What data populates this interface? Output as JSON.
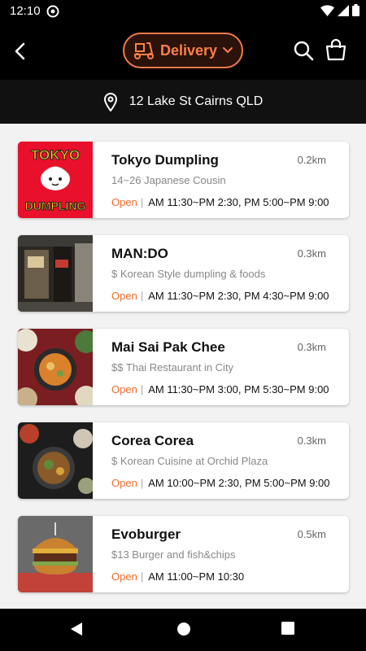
{
  "status_bar": {
    "time": "12:10"
  },
  "header": {
    "delivery_label": "Delivery"
  },
  "address": {
    "text": "12 Lake St Cairns QLD"
  },
  "restaurants": [
    {
      "name": "Tokyo Dumpling",
      "distance": "0.2km",
      "description": "14~26 Japanese Cousin",
      "status": "Open",
      "hours": "AM 11:30~PM 2:30, PM 5:00~PM 9:00",
      "thumb_text_top": "TOKYO",
      "thumb_text_bottom": "DUMPLING"
    },
    {
      "name": "MAN:DO",
      "distance": "0.3km",
      "description": "$ Korean Style dumpling & foods",
      "status": "Open",
      "hours": "AM 11:30~PM 2:30, PM 4:30~PM 9:00"
    },
    {
      "name": "Mai Sai Pak Chee",
      "distance": "0.3km",
      "description": "$$ Thai Restaurant in City",
      "status": "Open",
      "hours": "AM 11:30~PM 3:00, PM 5:30~PM 9:00"
    },
    {
      "name": "Corea Corea",
      "distance": "0.3km",
      "description": "$ Korean Cuisine at Orchid Plaza",
      "status": "Open",
      "hours": "AM 10:00~PM 2:30, PM 5:00~PM 9:00"
    },
    {
      "name": "Evoburger",
      "distance": "0.5km",
      "description": "$13 Burger and fish&chips",
      "status": "Open",
      "hours": "AM 11:00~PM 10:30"
    }
  ],
  "colors": {
    "accent": "#ff7f4a",
    "open": "#f06c2b",
    "header_bg": "#000000"
  },
  "icons": [
    "back-arrow-icon",
    "scooter-icon",
    "chevron-down-icon",
    "search-icon",
    "shopping-bag-icon",
    "location-pin-icon"
  ]
}
